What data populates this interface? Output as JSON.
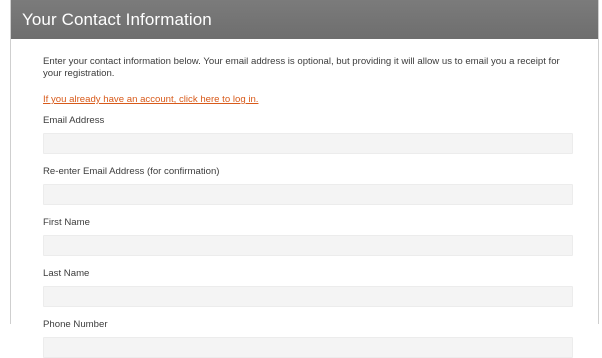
{
  "header": {
    "title": "Your Contact Information"
  },
  "intro": {
    "text": "Enter your contact information below. Your email address is optional, but providing it will allow us to email you a receipt for your registration."
  },
  "login_link": {
    "text": "If you already have an account, click here to log in."
  },
  "fields": {
    "email": {
      "label": "Email Address",
      "value": ""
    },
    "email_confirm": {
      "label": "Re-enter Email Address (for confirmation)",
      "value": ""
    },
    "first_name": {
      "label": "First Name",
      "value": ""
    },
    "last_name": {
      "label": "Last Name",
      "value": ""
    },
    "phone": {
      "label": "Phone Number",
      "value": ""
    }
  },
  "colors": {
    "header_bg": "#737373",
    "link": "#d85a1a",
    "input_bg": "#f4f4f4"
  }
}
